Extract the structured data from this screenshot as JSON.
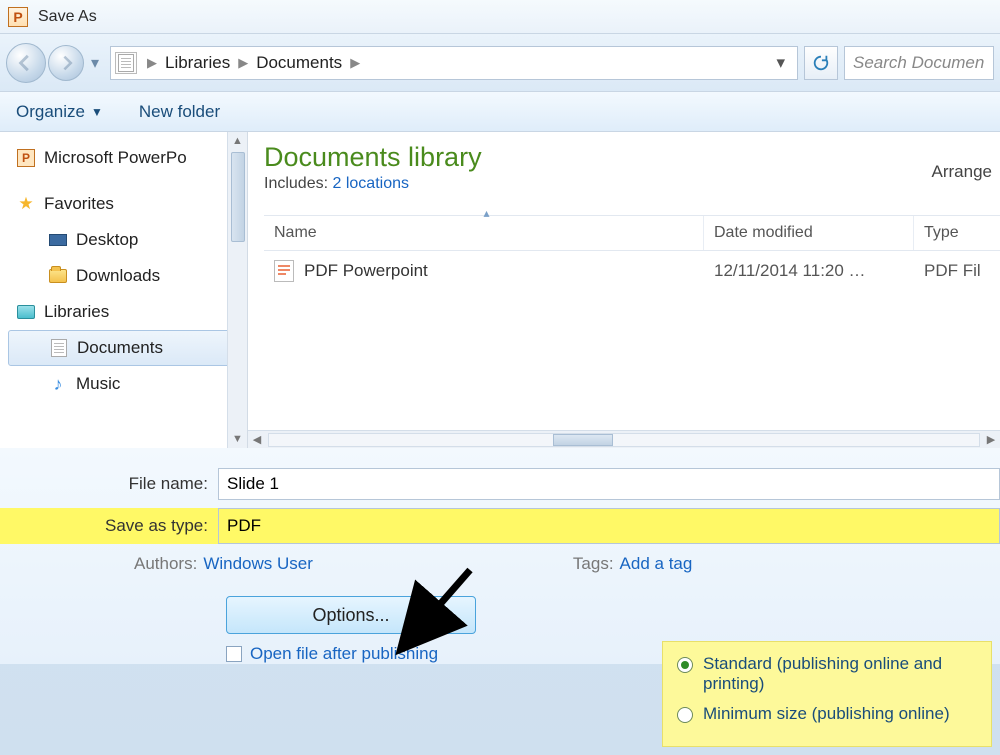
{
  "window": {
    "title": "Save As"
  },
  "breadcrumb": {
    "parts": [
      "Libraries",
      "Documents"
    ]
  },
  "search": {
    "placeholder": "Search Documen"
  },
  "toolbar": {
    "organize": "Organize",
    "newfolder": "New folder"
  },
  "sidebar": {
    "top_item": "Microsoft PowerPo",
    "fav_header": "Favorites",
    "fav_items": [
      "Desktop",
      "Downloads"
    ],
    "lib_header": "Libraries",
    "lib_items": [
      "Documents",
      "Music"
    ],
    "selected": "Documents"
  },
  "library": {
    "title": "Documents library",
    "includes_prefix": "Includes:",
    "includes_link": "2 locations",
    "arrange": "Arrange"
  },
  "columns": {
    "name": "Name",
    "date": "Date modified",
    "type": "Type"
  },
  "files": [
    {
      "name": "PDF Powerpoint",
      "date": "12/11/2014 11:20 …",
      "type": "PDF Fil"
    }
  ],
  "form": {
    "filename_label": "File name:",
    "filename_value": "Slide 1",
    "saveastype_label": "Save as type:",
    "saveastype_value": "PDF",
    "authors_label": "Authors:",
    "authors_value": "Windows User",
    "tags_label": "Tags:",
    "tags_value": "Add a tag",
    "options_button": "Options...",
    "open_after": "Open file after publishing"
  },
  "optimize": {
    "standard": "Standard (publishing online and printing)",
    "minimum": "Minimum size (publishing online)"
  }
}
